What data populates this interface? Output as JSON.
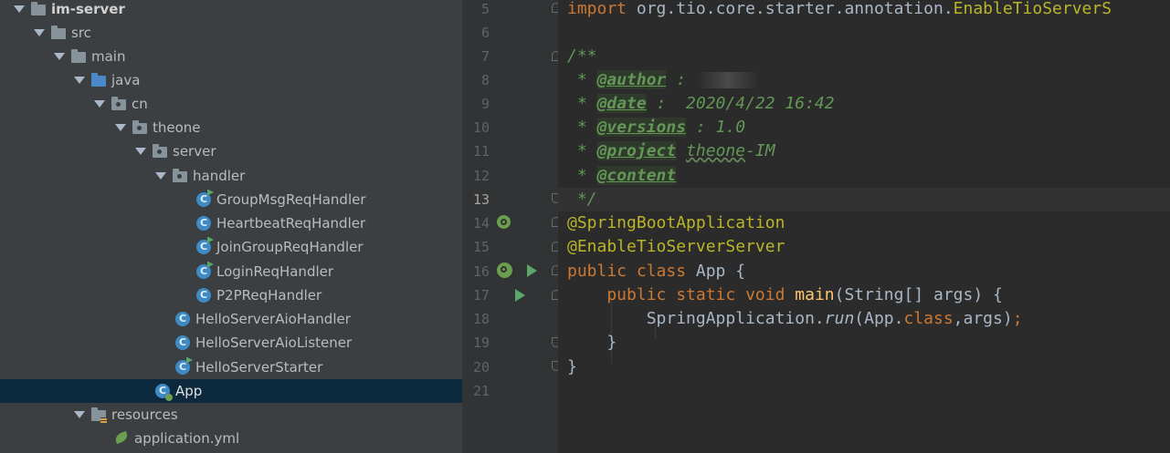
{
  "tree": {
    "items": [
      {
        "label": "im-server",
        "bold": true
      },
      {
        "label": "src"
      },
      {
        "label": "main"
      },
      {
        "label": "java"
      },
      {
        "label": "cn"
      },
      {
        "label": "theone"
      },
      {
        "label": "server"
      },
      {
        "label": "handler"
      },
      {
        "label": "GroupMsgReqHandler"
      },
      {
        "label": "HeartbeatReqHandler"
      },
      {
        "label": "JoinGroupReqHandler"
      },
      {
        "label": "LoginReqHandler"
      },
      {
        "label": "P2PReqHandler"
      },
      {
        "label": "HelloServerAioHandler"
      },
      {
        "label": "HelloServerAioListener"
      },
      {
        "label": "HelloServerStarter"
      },
      {
        "label": "App",
        "selected": true
      },
      {
        "label": "resources"
      },
      {
        "label": "application.yml"
      }
    ],
    "class_letter": "C"
  },
  "editor": {
    "line_numbers": [
      "5",
      "6",
      "7",
      "8",
      "9",
      "10",
      "11",
      "12",
      "13",
      "14",
      "15",
      "16",
      "17",
      "18",
      "19",
      "20",
      "21"
    ],
    "current_line": "13",
    "code": {
      "l5_kw": "import",
      "l5_pkg": " org.tio.core.starter.annotation.",
      "l5_cls": "EnableTioServerS",
      "l7": "/**",
      "l8_star": " * ",
      "l8_tag": "@author",
      "l8_rest": " : ",
      "l9_star": " * ",
      "l9_tag": "@date",
      "l9_rest": " :  2020/4/22 16:42",
      "l10_star": " * ",
      "l10_tag": "@versions",
      "l10_rest": " : 1.0",
      "l11_star": " * ",
      "l11_tag": "@project",
      "l11_sp": " ",
      "l11_word": "theone",
      "l11_rest": "-IM",
      "l12_star": " * ",
      "l12_tag": "@content",
      "l13": " */",
      "l14": "@SpringBootApplication",
      "l15": "@EnableTioServerServer",
      "l16_kw": "public class",
      "l16_rest": " App {",
      "l17_kw": "    public static void",
      "l17_sp": " ",
      "l17_fn": "main",
      "l17_rest": "(String[] args) {",
      "l18_a": "        SpringApplication.",
      "l18_run": "run",
      "l18_b": "(App.",
      "l18_kw": "class",
      "l18_c": ",args)",
      "l18_semi": ";",
      "l19": "    }",
      "l20": "}"
    }
  },
  "colors": {
    "tree_bg": "#3c3f41",
    "selection": "#0d293e",
    "editor_bg": "#2b2b2b",
    "gutter_bg": "#313335",
    "keyword": "#cc7832",
    "annotation": "#bbb529",
    "doc_comment": "#629755",
    "method": "#ffc66d"
  },
  "icons": [
    "expand-arrow-icon",
    "folder-icon",
    "source-folder-icon",
    "package-icon",
    "resources-folder-icon",
    "class-icon",
    "runnable-class-icon",
    "spring-app-class-icon",
    "spring-yml-icon",
    "run-gutter-icon",
    "spring-bean-gutter-icon",
    "intention-bulb-icon",
    "fold-icon"
  ]
}
